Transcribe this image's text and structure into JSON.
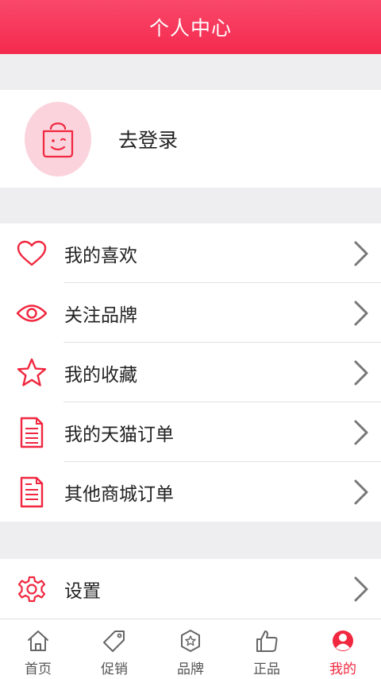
{
  "header": {
    "title": "个人中心"
  },
  "login": {
    "label": "去登录",
    "avatar_icon": "shopping-bag-smile-icon"
  },
  "menu": [
    {
      "label": "我的喜欢",
      "icon": "heart-icon"
    },
    {
      "label": "关注品牌",
      "icon": "eye-icon"
    },
    {
      "label": "我的收藏",
      "icon": "star-icon"
    },
    {
      "label": "我的天猫订单",
      "icon": "document-icon"
    },
    {
      "label": "其他商城订单",
      "icon": "document-icon"
    }
  ],
  "settings": {
    "label": "设置",
    "icon": "gear-icon"
  },
  "tabbar": [
    {
      "label": "首页",
      "icon": "home-icon",
      "active": false
    },
    {
      "label": "促销",
      "icon": "tag-icon",
      "active": false
    },
    {
      "label": "品牌",
      "icon": "brand-badge-icon",
      "active": false
    },
    {
      "label": "正品",
      "icon": "thumbs-up-icon",
      "active": false
    },
    {
      "label": "我的",
      "icon": "user-icon",
      "active": true
    }
  ],
  "colors": {
    "accent": "#f0273f",
    "header": "#f42a4e",
    "avatar_bg": "#fbd3dc",
    "background": "#eeeef0"
  }
}
